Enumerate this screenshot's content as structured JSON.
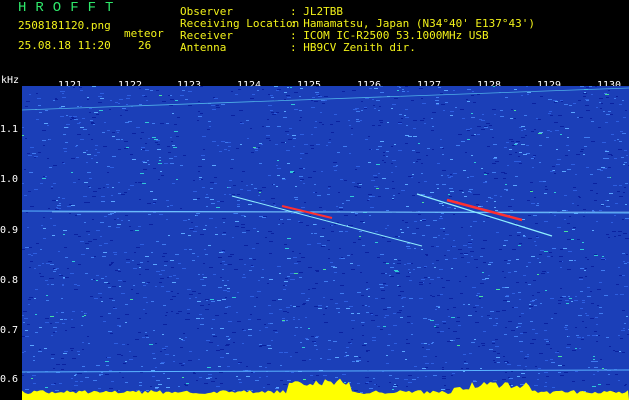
{
  "header": {
    "title": "HROFFT",
    "filename": "2508181120.png",
    "datetime": "25.08.18 11:20",
    "category_label": "meteor",
    "count": "26",
    "info_labels": {
      "observer": "Observer",
      "location": "Receiving Location",
      "receiver": "Receiver",
      "antenna": "Antenna"
    },
    "info_values": {
      "observer": ": JL2TBB",
      "location": ": Hamamatsu, Japan (N34°40' E137°43')",
      "receiver": ": ICOM IC-R2500 53.1000MHz USB",
      "antenna": ": HB9CV Zenith dir."
    }
  },
  "axes": {
    "y_unit": "kHz",
    "x_ticks": [
      "1121",
      "1122",
      "1123",
      "1124",
      "1125",
      "1126",
      "1127",
      "1128",
      "1129",
      "1130"
    ],
    "y_ticks": [
      "1.1",
      "1.0",
      "0.9",
      "0.8",
      "0.7",
      "0.6"
    ]
  },
  "colors": {
    "background": "#1b3fb8",
    "title": "#2ee86a",
    "info": "#f2f21a",
    "baseband": "#ffff00"
  }
}
